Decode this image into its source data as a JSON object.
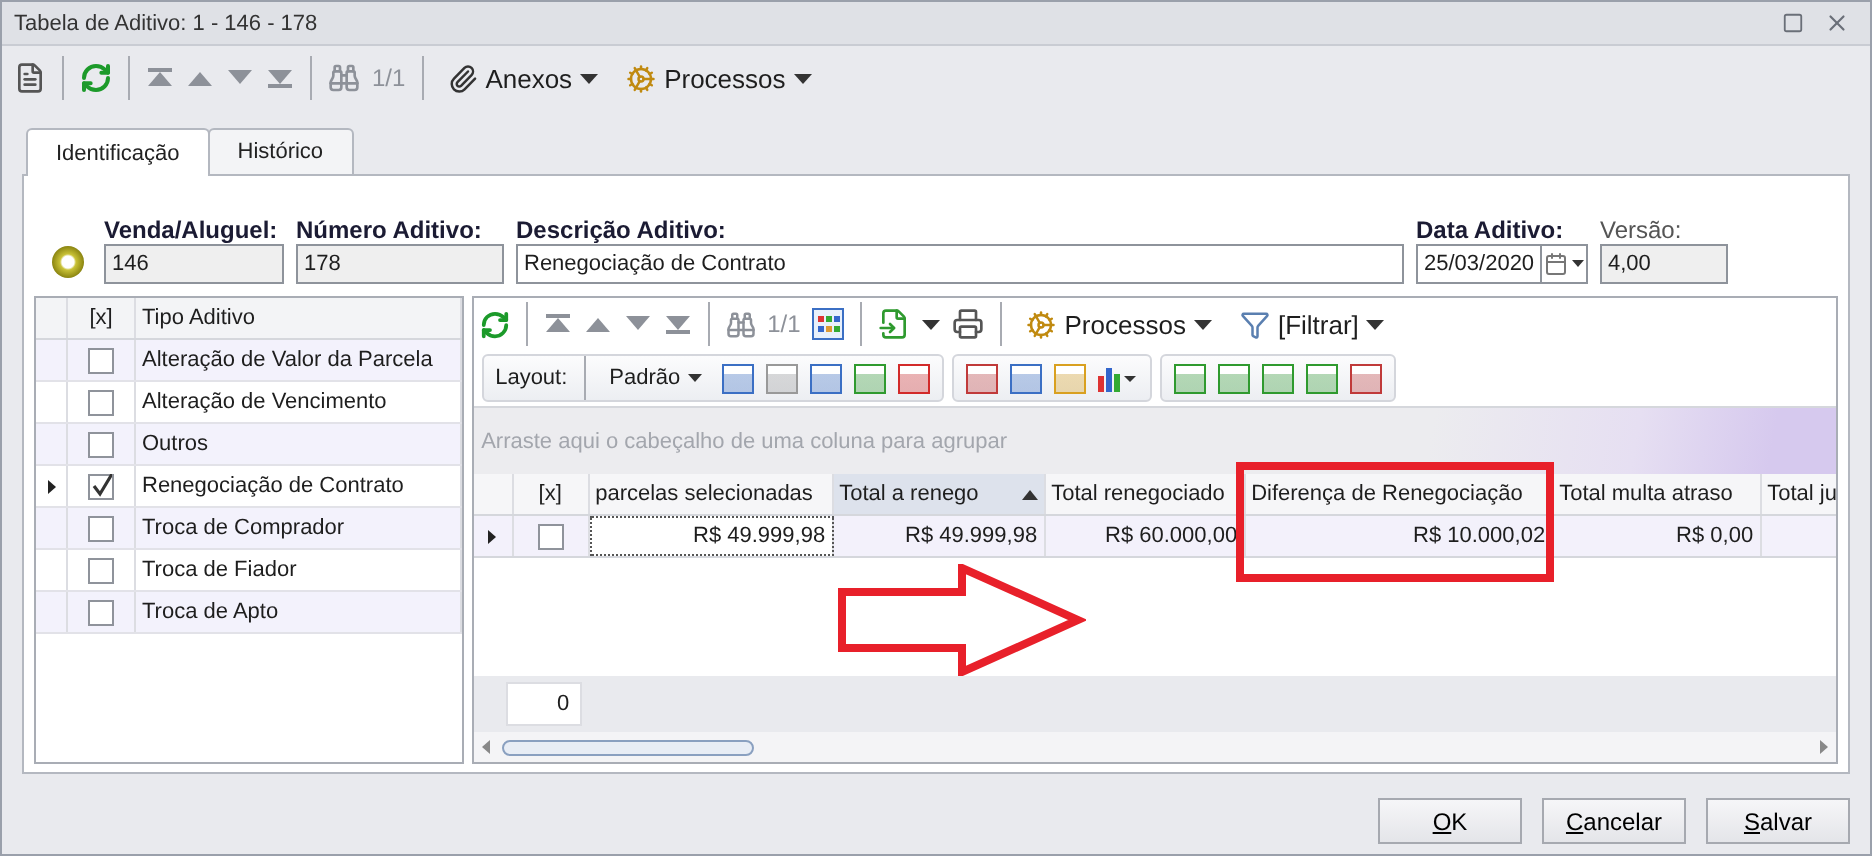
{
  "window": {
    "title": "Tabela de Aditivo: 1 - 146 - 178"
  },
  "toolbar": {
    "counter": "1/1",
    "menus": [
      "Anexos",
      "Processos"
    ]
  },
  "tabs": [
    {
      "label": "Identificação",
      "selected": true
    },
    {
      "label": "Histórico",
      "selected": false
    }
  ],
  "fields": [
    {
      "label": "Venda/Aluguel:",
      "value": "146",
      "kind": "readonly",
      "bold_label": true
    },
    {
      "label": "Número Aditivo:",
      "value": "178",
      "kind": "readonly",
      "bold_label": true
    },
    {
      "label": "Descrição Aditivo:",
      "value": "Renegociação de Contrato",
      "kind": "text",
      "bold_label": true
    },
    {
      "label": "Data Aditivo:",
      "value": "25/03/2020",
      "kind": "date",
      "bold_label": true
    },
    {
      "label": "Versão:",
      "value": "4,00",
      "kind": "readonly",
      "bold_label": false
    }
  ],
  "types_grid": {
    "check_header": "[x]",
    "label_header": "Tipo Aditivo",
    "rows": [
      {
        "label": "Alteração de Valor da Parcela",
        "checked": false,
        "selected": false
      },
      {
        "label": "Alteração de Vencimento",
        "checked": false,
        "selected": false
      },
      {
        "label": "Outros",
        "checked": false,
        "selected": false
      },
      {
        "label": "Renegociação de Contrato",
        "checked": true,
        "selected": true
      },
      {
        "label": "Troca de Comprador",
        "checked": false,
        "selected": false
      },
      {
        "label": "Troca de Fiador",
        "checked": false,
        "selected": false
      },
      {
        "label": "Troca de Apto",
        "checked": false,
        "selected": false
      }
    ]
  },
  "detail_toolbar": {
    "counter": "1/1",
    "menus": [
      "Processos",
      "[Filtrar]"
    ]
  },
  "layout_bar": {
    "label": "Layout:",
    "preset": "Padrão"
  },
  "group_panel": {
    "placeholder": "Arraste aqui o cabeçalho de uma coluna para agrupar"
  },
  "detail_grid": {
    "columns": [
      {
        "label": "[x]",
        "sorted": false
      },
      {
        "label": "parcelas selecionadas",
        "sorted": false
      },
      {
        "label": "Total a renego",
        "sorted": true
      },
      {
        "label": "Total renegociado",
        "sorted": false
      },
      {
        "label": "Diferença de Renegociação",
        "sorted": false
      },
      {
        "label": "Total multa atraso",
        "sorted": false
      },
      {
        "label": "Total ju",
        "sorted": false
      }
    ],
    "rows": [
      {
        "selected": true,
        "cells": [
          {
            "kind": "checkbox",
            "checked": false
          },
          {
            "kind": "text",
            "text": "R$ 49.999,98"
          },
          {
            "kind": "text",
            "text": "R$ 49.999,98"
          },
          {
            "kind": "text",
            "text": "R$ 60.000,00"
          },
          {
            "kind": "text",
            "text": "R$ 10.000,02"
          },
          {
            "kind": "text",
            "text": "R$ 0,00"
          }
        ]
      }
    ],
    "footer_count": "0"
  },
  "buttons": [
    "OK",
    "Cancelar",
    "Salvar"
  ]
}
